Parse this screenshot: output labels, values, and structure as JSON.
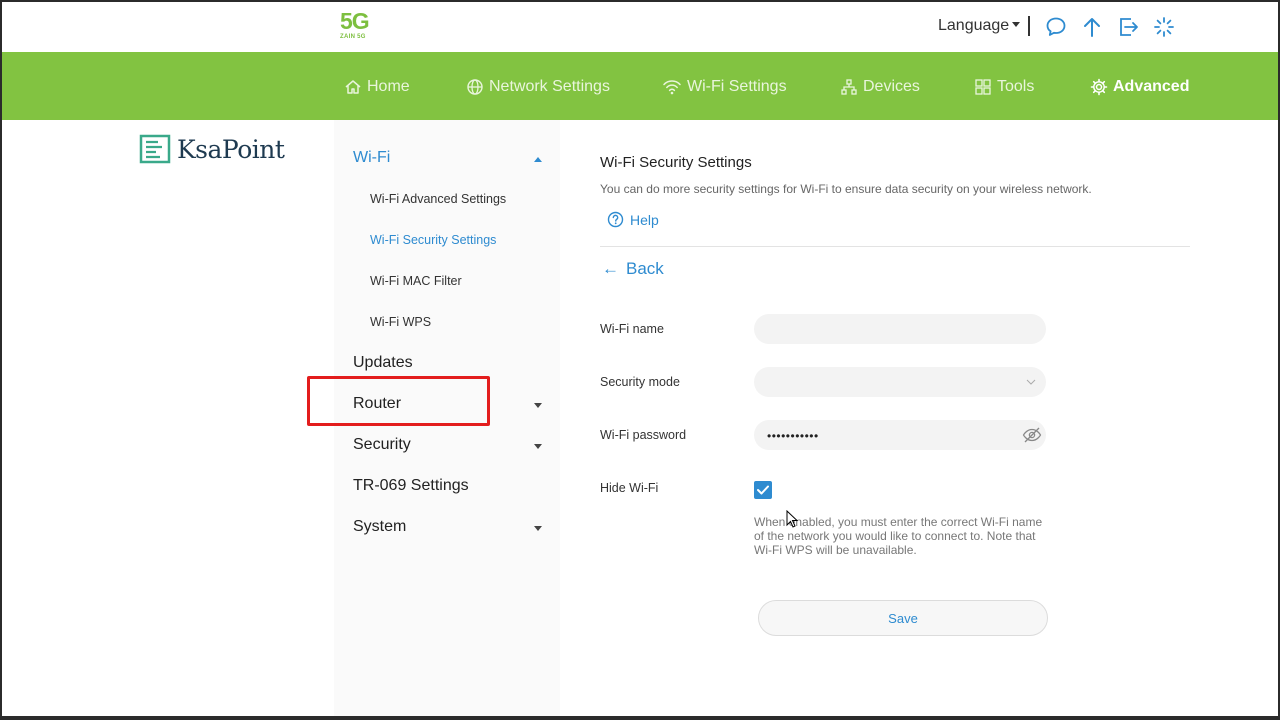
{
  "header": {
    "logo_main": "5G",
    "logo_sub": "ZAIN 5G",
    "language_label": "Language"
  },
  "nav": {
    "items": [
      {
        "label": "Home",
        "icon": "home-icon"
      },
      {
        "label": "Network Settings",
        "icon": "globe-icon"
      },
      {
        "label": "Wi-Fi Settings",
        "icon": "wifi-icon"
      },
      {
        "label": "Devices",
        "icon": "devices-icon"
      },
      {
        "label": "Tools",
        "icon": "tools-icon"
      },
      {
        "label": "Advanced",
        "icon": "gear-icon"
      }
    ],
    "active": "Advanced"
  },
  "brand": {
    "name": "KsaPoint"
  },
  "sidebar": {
    "wifi": "Wi-Fi",
    "wifi_sub": [
      "Wi-Fi Advanced Settings",
      "Wi-Fi Security Settings",
      "Wi-Fi MAC Filter",
      "Wi-Fi WPS"
    ],
    "updates": "Updates",
    "router": "Router",
    "security": "Security",
    "tr069": "TR-069 Settings",
    "system": "System"
  },
  "content": {
    "title": "Wi-Fi Security Settings",
    "description": "You can do more security settings for Wi-Fi to ensure data security on your wireless network.",
    "help": "Help",
    "back": "Back",
    "wifi_name_label": "Wi-Fi name",
    "wifi_name_value": "",
    "security_mode_label": "Security mode",
    "security_mode_value": "",
    "wifi_password_label": "Wi-Fi password",
    "wifi_password_value": "•••••••••••",
    "hide_wifi_label": "Hide Wi-Fi",
    "hide_wifi_checked": true,
    "hide_wifi_note": "When enabled, you must enter the correct Wi-Fi name of the network you would like to connect to. Note that Wi-Fi WPS will be unavailable.",
    "save": "Save"
  },
  "colors": {
    "nav_green": "#82c341",
    "accent_blue": "#2e8bd0",
    "highlight_red": "#e31d1d"
  }
}
